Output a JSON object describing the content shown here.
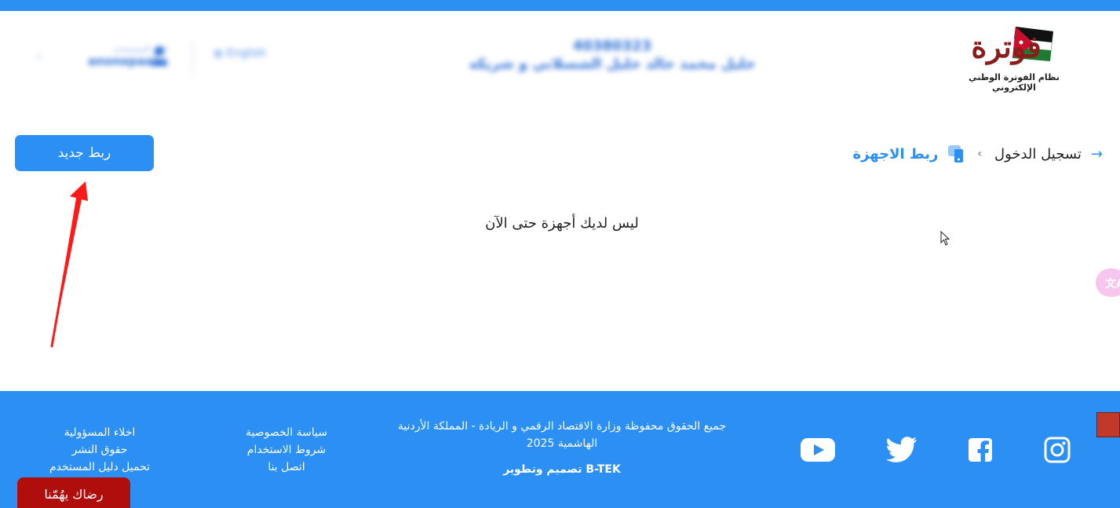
{
  "header": {
    "logo_word": "فوترة",
    "logo_sub": "نظام الفوترة الوطني الإلكتروني",
    "company_number": "40380323",
    "company_name": "خليل محمد خالد خليل الشسلاني و شريكه",
    "user_label": "اسم المستخدم",
    "user_name": "anonepaaks",
    "language": "English"
  },
  "breadcrumb": {
    "login": "تسجيل الدخول",
    "devices": "ربط الاجهزة"
  },
  "new_link_button": "ربط جديد",
  "empty_message": "ليس لديك أجهزة حتى الآن",
  "translate_label": "文A",
  "footer": {
    "rights": "جميع الحقوق محفوظة وزارة الاقتصاد الرقمي و الريادة - المملكة الأردنية الهاشمية 2025",
    "credit": "تصميم وتطوير B-TEK",
    "links_col1": [
      "سياسة الخصوصية",
      "شروط الاستخدام",
      "اتصل بنا"
    ],
    "links_col2": [
      "اخلاء المسؤولية",
      "حقوق النشر",
      "تحميل دليل المستخدم"
    ],
    "feedback": "رضاك يهُمّنا"
  },
  "colors": {
    "primary": "#2b8ff3",
    "logo_red": "#8b1c1c",
    "feedback_red": "#b00d0d",
    "annotation_arrow": "#ff1a1a"
  },
  "icons": [
    "back-arrow-icon",
    "device-icon",
    "user-icon",
    "globe-icon",
    "instagram-icon",
    "facebook-icon",
    "twitter-icon",
    "youtube-icon",
    "translate-icon"
  ]
}
